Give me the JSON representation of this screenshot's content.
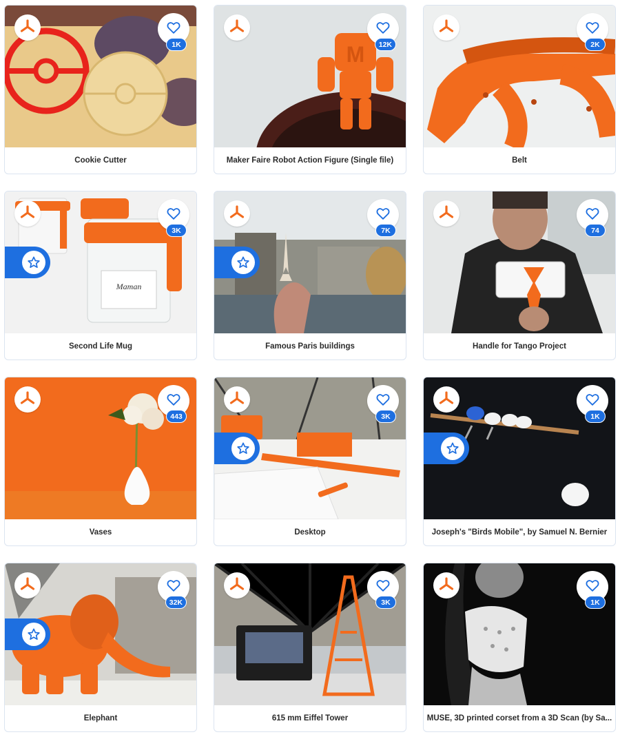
{
  "accent_color": "#1e6fe0",
  "brand_color": "#f26b1d",
  "cards": [
    {
      "title": "Cookie Cutter",
      "likes": "1K",
      "staff_pick": false,
      "scene": "cookie"
    },
    {
      "title": "Maker Faire Robot Action Figure (Single file)",
      "likes": "12K",
      "staff_pick": false,
      "scene": "robot"
    },
    {
      "title": "Belt",
      "likes": "2K",
      "staff_pick": false,
      "scene": "belt"
    },
    {
      "title": "Second Life Mug",
      "likes": "3K",
      "staff_pick": true,
      "scene": "mug"
    },
    {
      "title": "Famous Paris buildings",
      "likes": "7K",
      "staff_pick": true,
      "scene": "paris"
    },
    {
      "title": "Handle for Tango Project",
      "likes": "74",
      "staff_pick": false,
      "scene": "tango"
    },
    {
      "title": "Vases",
      "likes": "443",
      "staff_pick": false,
      "scene": "vase"
    },
    {
      "title": "Desktop",
      "likes": "3K",
      "staff_pick": true,
      "scene": "desktop"
    },
    {
      "title": "Joseph's \"Birds Mobile\", by Samuel N. Bernier",
      "likes": "1K",
      "staff_pick": true,
      "scene": "birds"
    },
    {
      "title": "Elephant",
      "likes": "32K",
      "staff_pick": true,
      "scene": "elephant"
    },
    {
      "title": "615 mm Eiffel Tower",
      "likes": "3K",
      "staff_pick": false,
      "scene": "eiffel"
    },
    {
      "title": "MUSE, 3D printed corset from a 3D Scan (by Sa...",
      "likes": "1K",
      "staff_pick": false,
      "scene": "corset"
    }
  ],
  "icons": {
    "logo": "cults-tripod-icon",
    "like": "heart-icon",
    "staff_pick": "star-icon"
  }
}
